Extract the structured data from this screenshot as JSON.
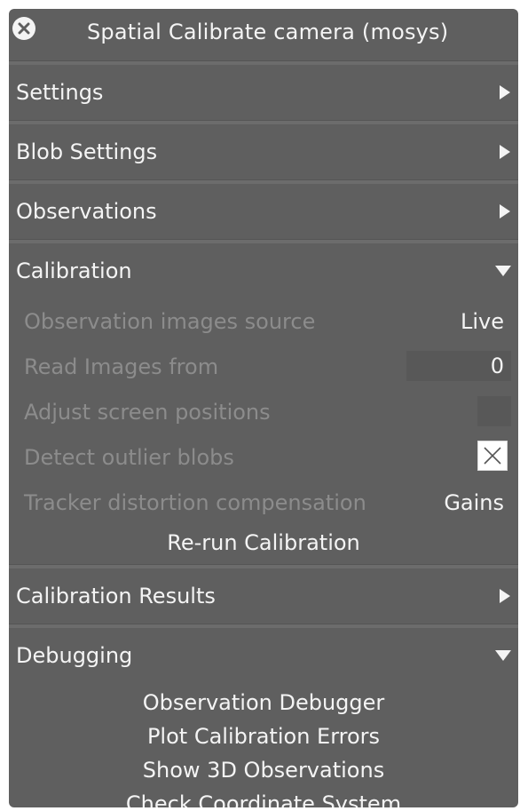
{
  "window": {
    "title": "Spatial Calibrate camera (mosys)",
    "close_icon": "close-icon"
  },
  "sections": {
    "settings": {
      "label": "Settings",
      "state": "collapsed"
    },
    "blob_settings": {
      "label": "Blob Settings",
      "state": "collapsed"
    },
    "observations": {
      "label": "Observations",
      "state": "collapsed"
    },
    "calibration": {
      "label": "Calibration",
      "state": "expanded",
      "rows": {
        "source": {
          "label": "Observation images source",
          "value": "Live"
        },
        "read_from": {
          "label": "Read Images from",
          "value": "0"
        },
        "adjust": {
          "label": "Adjust screen positions"
        },
        "outlier": {
          "label": "Detect outlier blobs",
          "checked": true
        },
        "distortion": {
          "label": "Tracker distortion compensation",
          "value": "Gains"
        }
      },
      "rerun_label": "Re-run Calibration"
    },
    "calibration_results": {
      "label": "Calibration Results",
      "state": "collapsed"
    },
    "debugging": {
      "label": "Debugging",
      "state": "expanded",
      "actions": [
        "Observation Debugger",
        "Plot Calibration Errors",
        "Show 3D Observations",
        "Check Coordinate System"
      ]
    }
  },
  "colors": {
    "panel_bg": "#5f5f5f",
    "text": "#f4f4f4",
    "disabled_text": "#8c8c8c"
  }
}
